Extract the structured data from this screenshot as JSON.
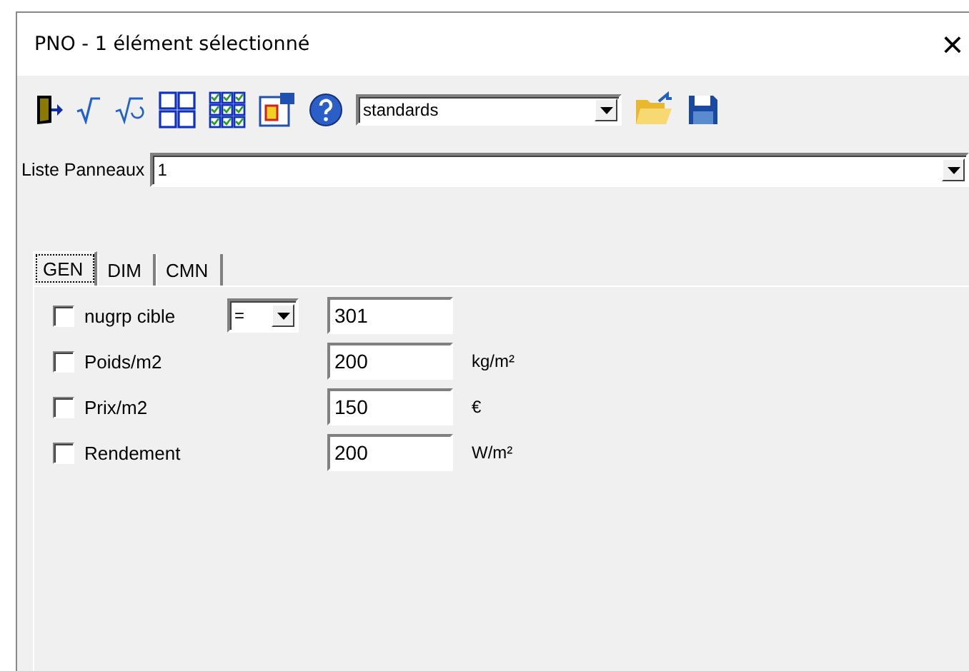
{
  "window": {
    "title": "PNO - 1 élément sélectionné",
    "close": "×"
  },
  "toolbar": {
    "preset": {
      "value": "standards"
    }
  },
  "liste_panneaux": {
    "label": "Liste Panneaux",
    "value": "1"
  },
  "tabs": [
    {
      "label": "GEN",
      "selected": true
    },
    {
      "label": "DIM",
      "selected": false
    },
    {
      "label": "CMN",
      "selected": false
    }
  ],
  "fields": [
    {
      "kind": "operator",
      "label": "nugrp cible",
      "checked": false,
      "operator": "=",
      "value": "301"
    },
    {
      "kind": "unit",
      "label": "Poids/m2",
      "checked": false,
      "value": "200",
      "unit": "kg/m²"
    },
    {
      "kind": "unit",
      "label": "Prix/m2",
      "checked": false,
      "value": "150",
      "unit": "€"
    },
    {
      "kind": "unit",
      "label": "Rendement",
      "checked": false,
      "value": "200",
      "unit": "W/m²"
    }
  ]
}
